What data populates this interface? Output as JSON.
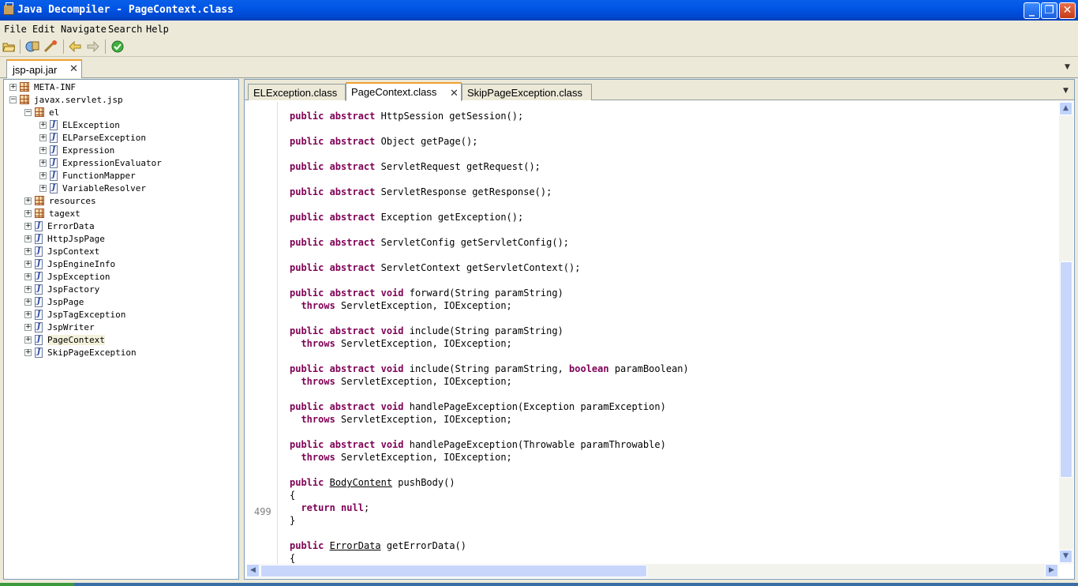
{
  "window": {
    "title": "Java Decompiler - PageContext.class",
    "buttons": {
      "minimize": "_",
      "maximize": "❐",
      "close": "✕"
    }
  },
  "menu": [
    "File",
    "Edit",
    "Navigate",
    "Search",
    "Help"
  ],
  "toolbar_icons": [
    "open-file-icon",
    "open-type-icon",
    "open-type-hierarchy-icon",
    "back-icon",
    "forward-icon",
    "about-icon"
  ],
  "jar_tab": {
    "label": "jsp-api.jar"
  },
  "tree": [
    {
      "label": "META-INF",
      "kind": "package",
      "level": 0,
      "expanded": false
    },
    {
      "label": "javax.servlet.jsp",
      "kind": "package",
      "level": 0,
      "expanded": true
    },
    {
      "label": "el",
      "kind": "package",
      "level": 1,
      "expanded": true
    },
    {
      "label": "ELException",
      "kind": "class",
      "level": 2,
      "expanded": false
    },
    {
      "label": "ELParseException",
      "kind": "class",
      "level": 2,
      "expanded": false
    },
    {
      "label": "Expression",
      "kind": "class",
      "level": 2,
      "expanded": false
    },
    {
      "label": "ExpressionEvaluator",
      "kind": "class",
      "level": 2,
      "expanded": false
    },
    {
      "label": "FunctionMapper",
      "kind": "class",
      "level": 2,
      "expanded": false
    },
    {
      "label": "VariableResolver",
      "kind": "class",
      "level": 2,
      "expanded": false
    },
    {
      "label": "resources",
      "kind": "package",
      "level": 1,
      "expanded": false
    },
    {
      "label": "tagext",
      "kind": "package",
      "level": 1,
      "expanded": false
    },
    {
      "label": "ErrorData",
      "kind": "class",
      "level": 1,
      "expanded": false
    },
    {
      "label": "HttpJspPage",
      "kind": "class",
      "level": 1,
      "expanded": false
    },
    {
      "label": "JspContext",
      "kind": "class",
      "level": 1,
      "expanded": false
    },
    {
      "label": "JspEngineInfo",
      "kind": "class",
      "level": 1,
      "expanded": false
    },
    {
      "label": "JspException",
      "kind": "class",
      "level": 1,
      "expanded": false
    },
    {
      "label": "JspFactory",
      "kind": "class",
      "level": 1,
      "expanded": false
    },
    {
      "label": "JspPage",
      "kind": "class",
      "level": 1,
      "expanded": false
    },
    {
      "label": "JspTagException",
      "kind": "class",
      "level": 1,
      "expanded": false
    },
    {
      "label": "JspWriter",
      "kind": "class",
      "level": 1,
      "expanded": false
    },
    {
      "label": "PageContext",
      "kind": "class",
      "level": 1,
      "expanded": false,
      "selected": true
    },
    {
      "label": "SkipPageException",
      "kind": "class",
      "level": 1,
      "expanded": false
    }
  ],
  "class_tabs": [
    {
      "label": "ELException.class",
      "active": false
    },
    {
      "label": "PageContext.class",
      "active": true
    },
    {
      "label": "SkipPageException.class",
      "active": false
    }
  ],
  "line_number": "499",
  "code_lines": [
    [],
    [
      [
        "kw",
        "public abstract"
      ],
      [
        "t",
        " HttpSession getSession();"
      ]
    ],
    [],
    [
      [
        "kw",
        "public abstract"
      ],
      [
        "t",
        " Object getPage();"
      ]
    ],
    [],
    [
      [
        "kw",
        "public abstract"
      ],
      [
        "t",
        " ServletRequest getRequest();"
      ]
    ],
    [],
    [
      [
        "kw",
        "public abstract"
      ],
      [
        "t",
        " ServletResponse getResponse();"
      ]
    ],
    [],
    [
      [
        "kw",
        "public abstract"
      ],
      [
        "t",
        " Exception getException();"
      ]
    ],
    [],
    [
      [
        "kw",
        "public abstract"
      ],
      [
        "t",
        " ServletConfig getServletConfig();"
      ]
    ],
    [],
    [
      [
        "kw",
        "public abstract"
      ],
      [
        "t",
        " ServletContext getServletContext();"
      ]
    ],
    [],
    [
      [
        "kw",
        "public abstract void"
      ],
      [
        "t",
        " forward(String paramString)"
      ]
    ],
    [
      [
        "t",
        "  "
      ],
      [
        "kw",
        "throws"
      ],
      [
        "t",
        " ServletException, IOException;"
      ]
    ],
    [],
    [
      [
        "kw",
        "public abstract void"
      ],
      [
        "t",
        " include(String paramString)"
      ]
    ],
    [
      [
        "t",
        "  "
      ],
      [
        "kw",
        "throws"
      ],
      [
        "t",
        " ServletException, IOException;"
      ]
    ],
    [],
    [
      [
        "kw",
        "public abstract void"
      ],
      [
        "t",
        " include(String paramString, "
      ],
      [
        "kw",
        "boolean"
      ],
      [
        "t",
        " paramBoolean)"
      ]
    ],
    [
      [
        "t",
        "  "
      ],
      [
        "kw",
        "throws"
      ],
      [
        "t",
        " ServletException, IOException;"
      ]
    ],
    [],
    [
      [
        "kw",
        "public abstract void"
      ],
      [
        "t",
        " handlePageException(Exception paramException)"
      ]
    ],
    [
      [
        "t",
        "  "
      ],
      [
        "kw",
        "throws"
      ],
      [
        "t",
        " ServletException, IOException;"
      ]
    ],
    [],
    [
      [
        "kw",
        "public abstract void"
      ],
      [
        "t",
        " handlePageException(Throwable paramThrowable)"
      ]
    ],
    [
      [
        "t",
        "  "
      ],
      [
        "kw",
        "throws"
      ],
      [
        "t",
        " ServletException, IOException;"
      ]
    ],
    [],
    [
      [
        "kw",
        "public"
      ],
      [
        "t",
        " "
      ],
      [
        "u",
        "BodyContent"
      ],
      [
        "t",
        " pushBody()"
      ]
    ],
    [
      [
        "t",
        "{"
      ]
    ],
    [
      [
        "t",
        "  "
      ],
      [
        "kw",
        "return null"
      ],
      [
        "t",
        ";"
      ]
    ],
    [
      [
        "t",
        "}"
      ]
    ],
    [],
    [
      [
        "kw",
        "public"
      ],
      [
        "t",
        " "
      ],
      [
        "u",
        "ErrorData"
      ],
      [
        "t",
        " getErrorData()"
      ]
    ],
    [
      [
        "t",
        "{"
      ]
    ]
  ],
  "colors": {
    "keyword": "#7f0055",
    "titlebar": "#0055e5",
    "active_tab_accent": "#f0a030"
  }
}
